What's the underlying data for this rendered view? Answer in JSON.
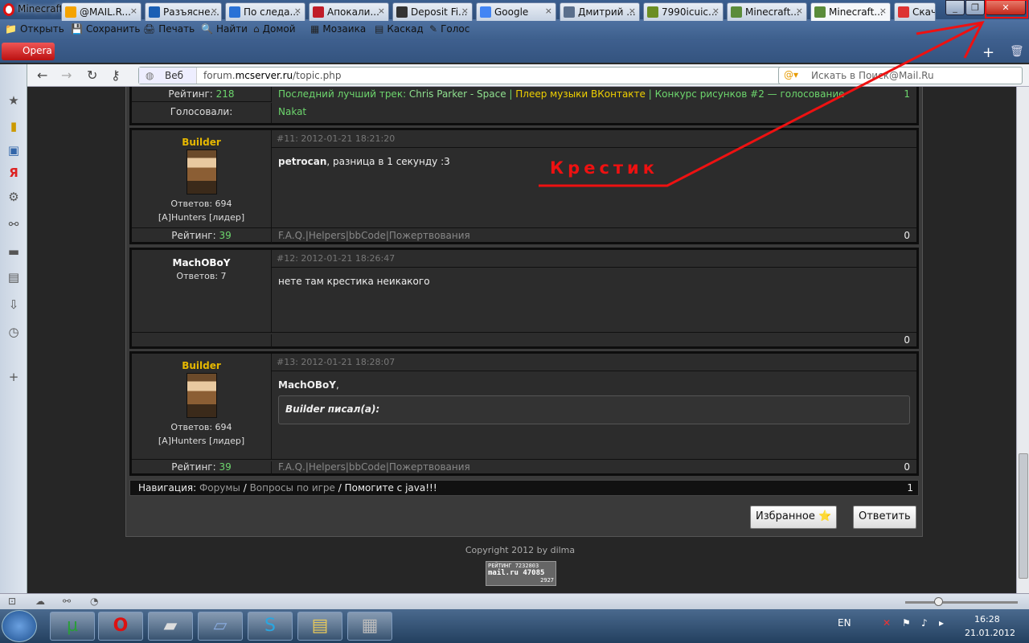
{
  "window": {
    "title": "Minecraft forum - Opera",
    "min": "_",
    "max": "❐",
    "close": "✕"
  },
  "menu": [
    {
      "icon": "📁",
      "label": "Открыть"
    },
    {
      "icon": "💾",
      "label": "Сохранить"
    },
    {
      "icon": "🖨",
      "label": "Печать"
    },
    {
      "icon": "🔍",
      "label": "Найти"
    },
    {
      "icon": "⌂",
      "label": "Домой"
    },
    {
      "icon": "▦",
      "label": "Мозаика"
    },
    {
      "icon": "▤",
      "label": "Каскад"
    },
    {
      "icon": "✎",
      "label": "Голос"
    }
  ],
  "opera_button": "Opera",
  "tabs": [
    {
      "label": "@MAIL.R...",
      "fav": "#f4a300"
    },
    {
      "label": "Разъясне...",
      "fav": "#1a5fb4"
    },
    {
      "label": "По следа...",
      "fav": "#2a72d6"
    },
    {
      "label": "Апокали...",
      "fav": "#c01c28"
    },
    {
      "label": "Deposit Fi...",
      "fav": "#333333"
    },
    {
      "label": "Google",
      "fav": "#4285f4"
    },
    {
      "label": "Дмитрий ...",
      "fav": "#5a6f8c"
    },
    {
      "label": "7990icuic...",
      "fav": "#6b8e23"
    },
    {
      "label": "Minecraft...",
      "fav": "#5b8c3a"
    },
    {
      "label": "Minecraft...",
      "fav": "#5b8c3a"
    },
    {
      "label": "Скачать J...",
      "fav": "#d33"
    }
  ],
  "address": {
    "mode": "Веб",
    "url_prefix": "forum.",
    "url_host": "mcserver.ru",
    "url_path": "/topic.php",
    "search_placeholder": "Искать в Поиск@Mail.Ru"
  },
  "top_rows": {
    "rating_label": "Рейтинг:",
    "rating_value": "218",
    "status_text_1": "Последний лучший трек: ",
    "status_text_2": "Chris Parker - Space",
    "status_text_3": " | ",
    "status_text_4": "Плеер музыки ВКонтакте",
    "status_text_5": " | Конкурс рисунков #2 — голосование",
    "status_num": "1",
    "voted_label": "Голосовали:",
    "voted_value": "Nakat"
  },
  "posts": [
    {
      "author": "Builder",
      "replies": "Ответов: 694",
      "clan": "[A]Hunters [лидер]",
      "meta": "#11: 2012-01-21 18:21:20",
      "bold": "petrocan",
      "text": ", разница в 1 секунду :3",
      "rating_label": "Рейтинг:",
      "rating": "39",
      "links": "F.A.Q.|Helpers|bbCode|Пожертвования",
      "count": "0"
    },
    {
      "author": "MachOBoY",
      "replies": "Ответов: 7",
      "meta": "#12: 2012-01-21 18:26:47",
      "text": "нете там крестика неикакого",
      "count": "0"
    },
    {
      "author": "Builder",
      "replies": "Ответов: 694",
      "clan": "[A]Hunters [лидер]",
      "meta": "#13: 2012-01-21 18:28:07",
      "bold": "MachOBoY",
      "text": ",",
      "quote": "Builder писал(а):",
      "rating_label": "Рейтинг:",
      "rating": "39",
      "links": "F.A.Q.|Helpers|bbCode|Пожертвования",
      "count": "0"
    }
  ],
  "navigation": {
    "label": "Навигация:",
    "crumb1": "Форумы",
    "sep": " / ",
    "crumb2": "Вопросы по игре",
    "crumb3": "Помогите с java!!!",
    "page": "1"
  },
  "buttons": {
    "favorite": "Избранное ⭐",
    "reply": "Ответить"
  },
  "copyright": "Copyright 2012 by dilma",
  "counter": {
    "line1": "РЕЙТИНГ  7232803",
    "line2": "mail.ru   47085",
    "line3": "2927"
  },
  "annotation": "Крестик",
  "taskbar": {
    "lang": "EN",
    "time": "16:28",
    "date": "21.01.2012"
  }
}
